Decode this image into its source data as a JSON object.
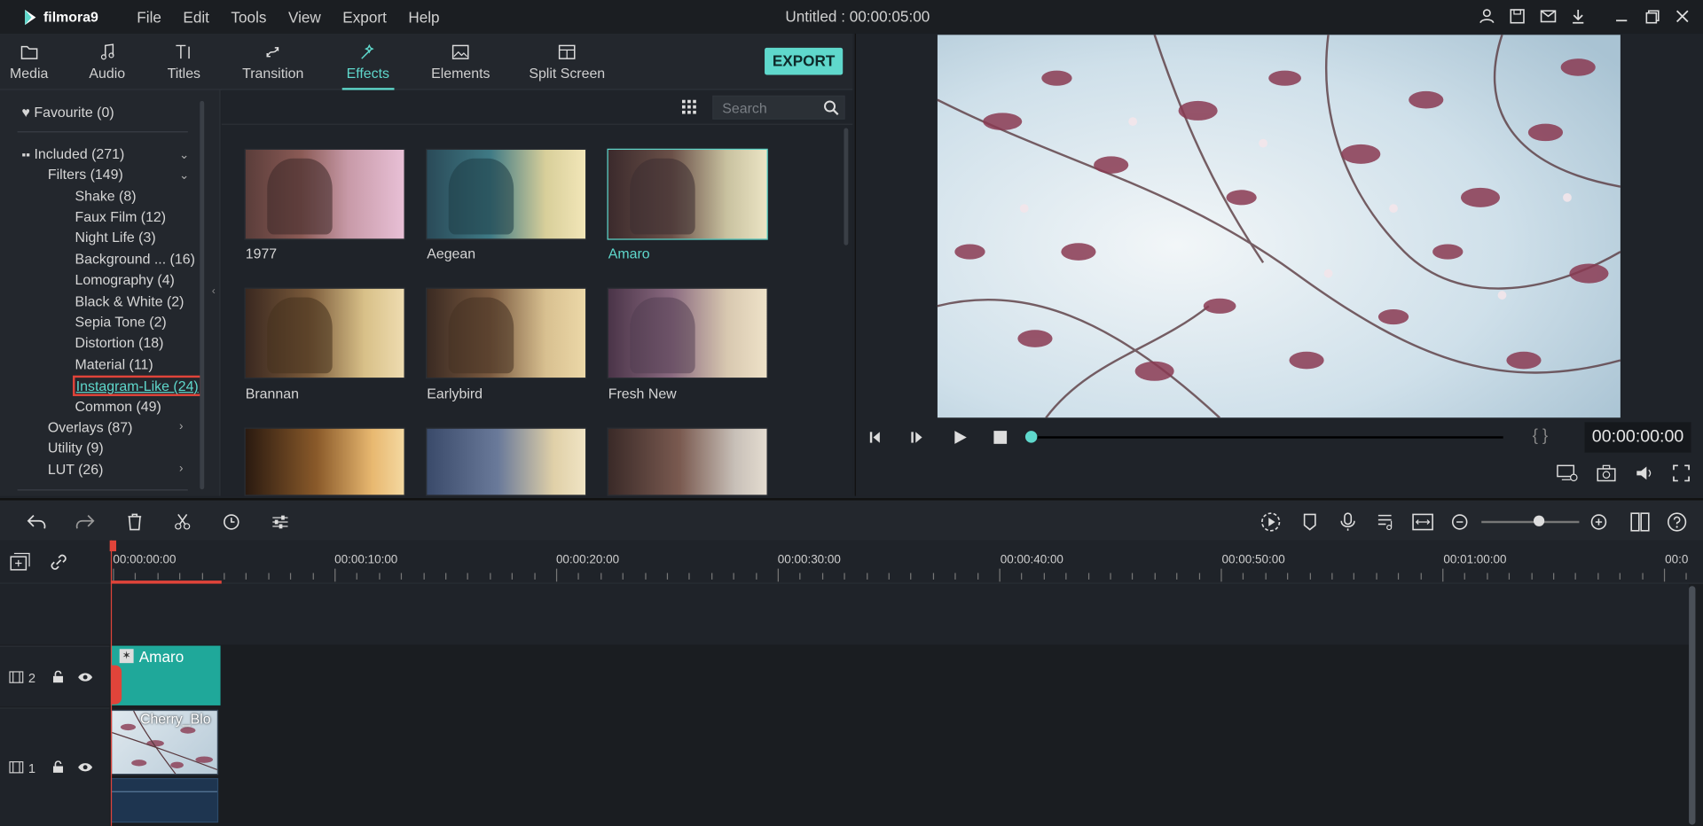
{
  "app": {
    "name": "filmora9",
    "title": "Untitled : 00:00:05:00"
  },
  "menu": [
    "File",
    "Edit",
    "Tools",
    "View",
    "Export",
    "Help"
  ],
  "window_icons": [
    "account-icon",
    "save-icon",
    "mail-icon",
    "download-icon",
    "minimize-icon",
    "restore-icon",
    "close-icon"
  ],
  "tabs": [
    {
      "label": "Media",
      "icon": "folder-icon"
    },
    {
      "label": "Audio",
      "icon": "music-note-icon"
    },
    {
      "label": "Titles",
      "icon": "text-icon"
    },
    {
      "label": "Transition",
      "icon": "transition-icon"
    },
    {
      "label": "Effects",
      "icon": "effects-icon",
      "active": true
    },
    {
      "label": "Elements",
      "icon": "image-icon"
    },
    {
      "label": "Split Screen",
      "icon": "split-screen-icon"
    }
  ],
  "export_label": "EXPORT",
  "tree": {
    "favourite": "Favourite (0)",
    "included": "Included (271)",
    "filters": "Filters (149)",
    "items": [
      "Shake (8)",
      "Faux Film (12)",
      "Night Life (3)",
      "Background ... (16)",
      "Lomography (4)",
      "Black & White (2)",
      "Sepia Tone (2)",
      "Distortion (18)",
      "Material (11)",
      "Instagram-Like (24)",
      "Common (49)"
    ],
    "overlays": "Overlays (87)",
    "utility": "Utility (9)",
    "lut": "LUT (26)"
  },
  "search": {
    "placeholder": "Search"
  },
  "effects": [
    "1977",
    "Aegean",
    "Amaro",
    "Brannan",
    "Earlybird",
    "Fresh New"
  ],
  "selected_effect": "Amaro",
  "preview": {
    "timecode": "00:00:00:00",
    "brackets": "{ }"
  },
  "ruler": [
    "00:00:00:00",
    "00:00:10:00",
    "00:00:20:00",
    "00:00:30:00",
    "00:00:40:00",
    "00:00:50:00",
    "00:01:00:00",
    "00:0"
  ],
  "tracks": {
    "track2": {
      "number": "2",
      "clip": "Amaro"
    },
    "track1": {
      "number": "1",
      "clip": "Cherry_Blo"
    }
  },
  "colors": {
    "accent": "#5fd8cc",
    "highlight": "#e0443a",
    "clip_teal": "#1fa89a"
  }
}
